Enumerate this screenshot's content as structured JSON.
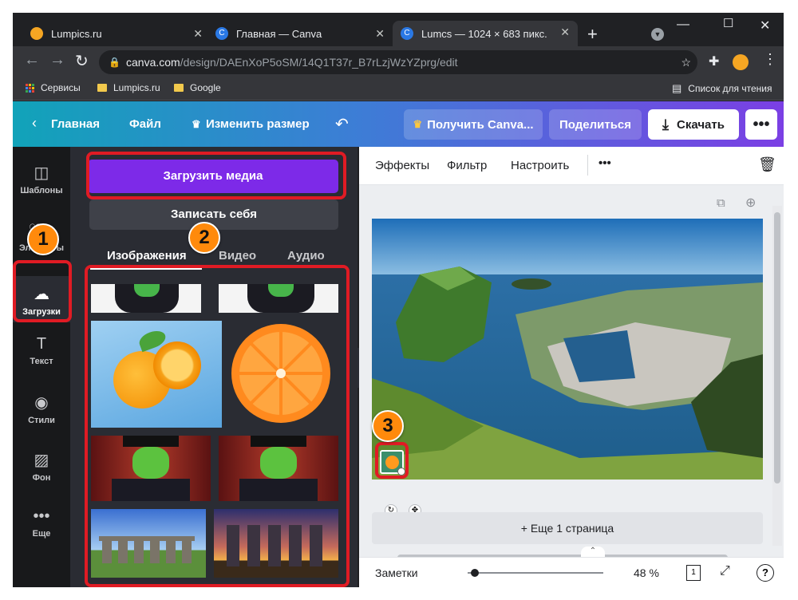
{
  "browser": {
    "tabs": [
      {
        "title": "Lumpics.ru",
        "favicon_color": "#f5a623"
      },
      {
        "title": "Главная — Canva",
        "favicon_color": "#2a78e4"
      },
      {
        "title": "Lumcs — 1024 × 683 пикс.",
        "favicon_color": "#2a78e4"
      }
    ],
    "url_domain": "canva.com",
    "url_path": "/design/DAEnXoP5oSM/14Q1T37r_B7rLzjWzYZprg/edit",
    "bookmarks": [
      "Сервисы",
      "Lumpics.ru",
      "Google"
    ],
    "reading_list": "Список для чтения"
  },
  "canva_toolbar": {
    "home": "Главная",
    "file": "Файл",
    "resize": "Изменить размер",
    "get_pro": "Получить Canva...",
    "share": "Поделиться",
    "download": "Скачать"
  },
  "sidebar": [
    {
      "label": "Шаблоны",
      "icon": "layout-icon"
    },
    {
      "label": "Элементы",
      "icon": "elements-icon"
    },
    {
      "label": "Загрузки",
      "icon": "upload-cloud-icon"
    },
    {
      "label": "Текст",
      "icon": "text-icon"
    },
    {
      "label": "Стили",
      "icon": "palette-icon"
    },
    {
      "label": "Фон",
      "icon": "background-icon"
    },
    {
      "label": "Еще",
      "icon": "more-icon"
    }
  ],
  "panel": {
    "upload_button": "Загрузить медиа",
    "record_button": "Записать себя",
    "tabs": [
      "Изображения",
      "Видео",
      "Аудио"
    ]
  },
  "context_toolbar": [
    "Эффекты",
    "Фильтр",
    "Настроить"
  ],
  "canvas": {
    "more_pages": "+ Еще 1 страница"
  },
  "bottom_bar": {
    "notes": "Заметки",
    "zoom": "48 %",
    "zoom_fraction": 0.05,
    "page_count": "1",
    "help": "?"
  },
  "callouts": [
    "1",
    "2",
    "3"
  ],
  "colors": {
    "accent": "#7d2ae8",
    "highlight": "#e01b24",
    "badge": "#ff8a0c"
  }
}
